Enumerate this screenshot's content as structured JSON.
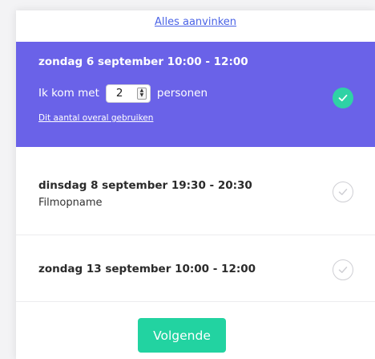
{
  "select_all_label": "Alles aanvinken",
  "colors": {
    "selected_bg": "#6a62e8",
    "check_on": "#2fd2a5",
    "button_bg": "#22d3a1",
    "link": "#4a63e6"
  },
  "slots": [
    {
      "title": "zondag 6 september 10:00 - 12:00",
      "selected": true,
      "persons_prefix": "Ik kom met",
      "persons_value": "2",
      "persons_suffix": "personen",
      "use_everywhere_label": "Dit aantal overal gebruiken",
      "icon": "check-circle-icon"
    },
    {
      "title": "dinsdag 8 september 19:30 - 20:30",
      "subtitle": "Filmopname",
      "selected": false,
      "icon": "check-circle-outline-icon"
    },
    {
      "title": "zondag 13 september 10:00 - 12:00",
      "selected": false,
      "icon": "check-circle-outline-icon"
    }
  ],
  "next_button_label": "Volgende"
}
